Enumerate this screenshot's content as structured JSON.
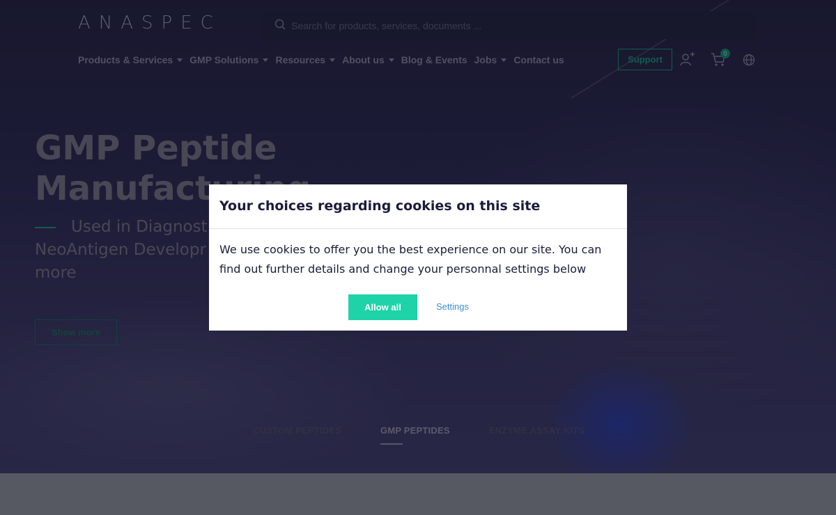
{
  "header": {
    "logo_text": "ANASPEC",
    "search_placeholder": "Search for products, services, documents ...",
    "support_label": "Support",
    "cart_count": "0",
    "icons": [
      "search-icon",
      "user-add-icon",
      "cart-icon",
      "globe-icon"
    ]
  },
  "nav": {
    "items": [
      {
        "label": "Products & Services",
        "has_dropdown": true
      },
      {
        "label": "GMP Solutions",
        "has_dropdown": true
      },
      {
        "label": "Resources",
        "has_dropdown": true
      },
      {
        "label": "About us",
        "has_dropdown": true
      },
      {
        "label": "Blog & Events",
        "has_dropdown": false
      },
      {
        "label": "Jobs",
        "has_dropdown": true
      },
      {
        "label": "Contact us",
        "has_dropdown": false
      }
    ]
  },
  "hero": {
    "title_line1": "GMP Peptide",
    "title_line2": "Manufacturing",
    "subtitle_line1": "Used in Diagnost",
    "subtitle_line2": "NeoAntigen Developr",
    "subtitle_line3": "more",
    "show_more_label": "Show more"
  },
  "tabs": [
    {
      "label": "CUSTOM PEPTIDES",
      "active": false
    },
    {
      "label": "GMP PEPTIDES",
      "active": true
    },
    {
      "label": "ENZYME ASSAY KITS",
      "active": false
    }
  ],
  "cookie_modal": {
    "title": "Your choices regarding cookies on this site",
    "body": "We use cookies to offer you the best experience on our site. You can find out further details and change your personnal settings below",
    "allow_label": "Allow all",
    "settings_label": "Settings"
  },
  "colors": {
    "accent": "#1ed3a8",
    "link": "#3b8fd7",
    "hero_dark": "#2a2948"
  }
}
